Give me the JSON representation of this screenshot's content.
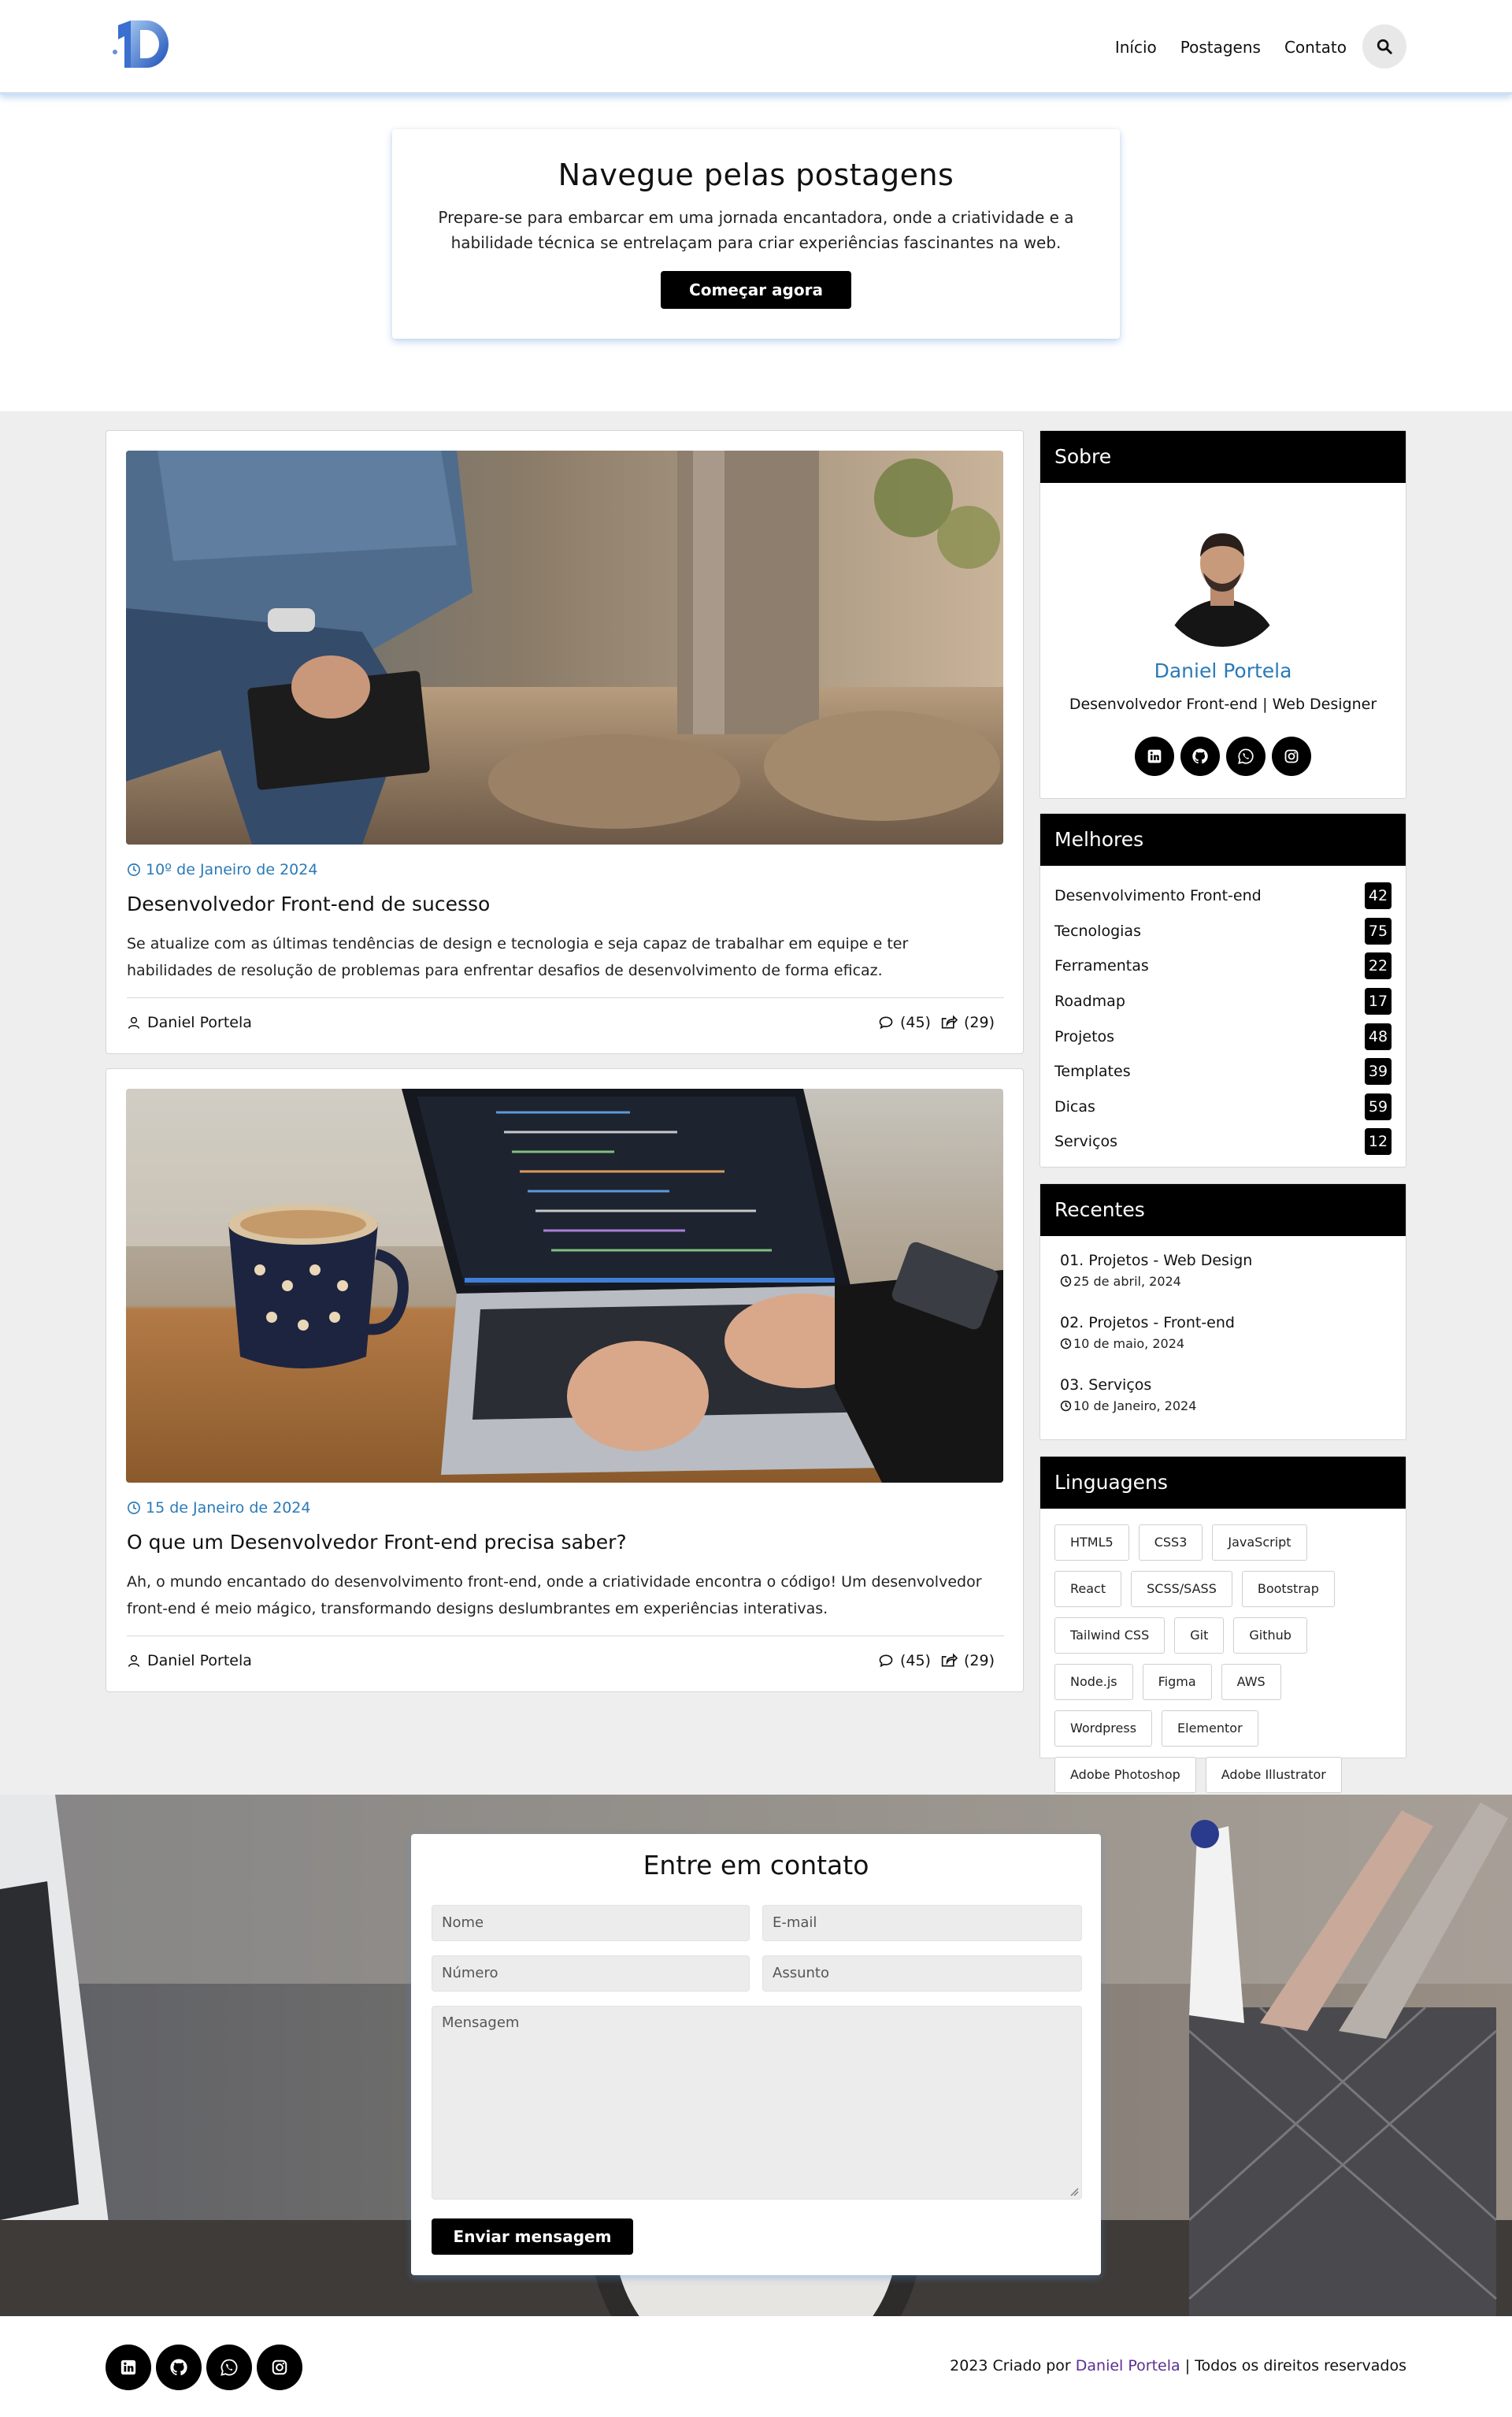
{
  "nav": {
    "links": [
      "Início",
      "Postagens",
      "Contato"
    ]
  },
  "hero": {
    "title": "Navegue pelas postagens",
    "text": "Prepare-se para embarcar em uma jornada encantadora, onde a criatividade e a habilidade técnica se entrelaçam para criar experiências fascinantes na web.",
    "button": "Começar agora"
  },
  "posts": [
    {
      "date": "10º de Janeiro de 2024",
      "title": "Desenvolvedor Front-end de sucesso",
      "text": "Se atualize com as últimas tendências de design e tecnologia e seja capaz de trabalhar em equipe e ter habilidades de resolução de problemas para enfrentar desafios de desenvolvimento de forma eficaz.",
      "author": "Daniel Portela",
      "comments": "(45)",
      "shares": "(29)"
    },
    {
      "date": "15 de Janeiro de 2024",
      "title": "O que um Desenvolvedor Front-end precisa saber?",
      "text": "Ah, o mundo encantado do desenvolvimento front-end, onde a criatividade encontra o código! Um desenvolvedor front-end é meio mágico, transformando designs deslumbrantes em experiências interativas.",
      "author": "Daniel Portela",
      "comments": "(45)",
      "shares": "(29)"
    }
  ],
  "about": {
    "heading": "Sobre",
    "name": "Daniel Portela",
    "role": "Desenvolvedor Front-end | Web Designer"
  },
  "best": {
    "heading": "Melhores",
    "items": [
      {
        "label": "Desenvolvimento Front-end",
        "count": "42"
      },
      {
        "label": "Tecnologias",
        "count": "75"
      },
      {
        "label": "Ferramentas",
        "count": "22"
      },
      {
        "label": "Roadmap",
        "count": "17"
      },
      {
        "label": "Projetos",
        "count": "48"
      },
      {
        "label": "Templates",
        "count": "39"
      },
      {
        "label": "Dicas",
        "count": "59"
      },
      {
        "label": "Serviços",
        "count": "12"
      }
    ]
  },
  "recent": {
    "heading": "Recentes",
    "items": [
      {
        "title": "01. Projetos - Web Design",
        "date": "25 de abril, 2024"
      },
      {
        "title": "02. Projetos - Front-end",
        "date": "10 de maio, 2024"
      },
      {
        "title": "03. Serviços",
        "date": "10 de Janeiro, 2024"
      }
    ]
  },
  "languages": {
    "heading": "Linguagens",
    "tags": [
      "HTML5",
      "CSS3",
      "JavaScript",
      "React",
      "SCSS/SASS",
      "Bootstrap",
      "Tailwind CSS",
      "Git",
      "Github",
      "Node.js",
      "Figma",
      "AWS",
      "Wordpress",
      "Elementor",
      "Adobe Photoshop",
      "Adobe Illustrator"
    ]
  },
  "contact": {
    "title": "Entre em contato",
    "name_placeholder": "Nome",
    "email_placeholder": "E-mail",
    "number_placeholder": "Número",
    "subject_placeholder": "Assunto",
    "message_placeholder": "Mensagem",
    "button": "Enviar mensagem"
  },
  "footer": {
    "prefix": "2023 Criado por ",
    "author": "Daniel Portela",
    "suffix": " | Todos os direitos reservados"
  },
  "icons": {
    "social": [
      "linkedin-icon",
      "github-icon",
      "whatsapp-icon",
      "instagram-icon"
    ]
  },
  "colors": {
    "accent": "#2a7ab8",
    "dark": "#000000",
    "background": "#eeeeee",
    "footer_link": "#5b2f92"
  }
}
